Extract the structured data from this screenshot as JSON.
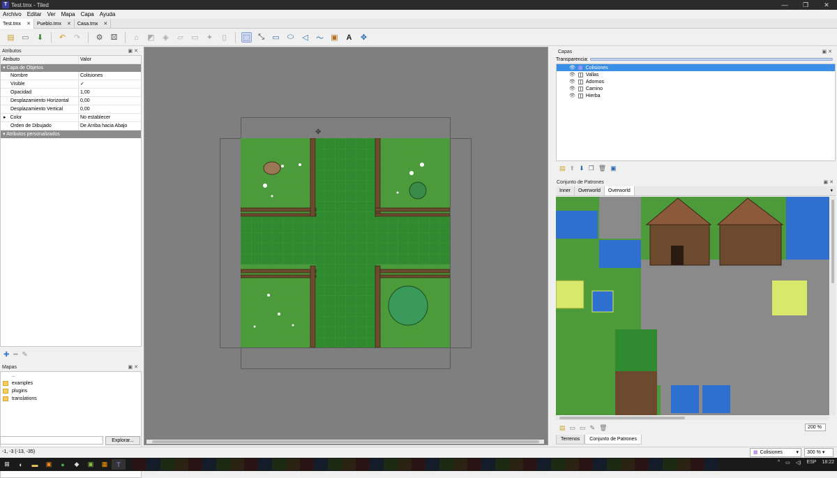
{
  "window": {
    "title": "Test.tmx - Tiled",
    "controls": [
      "—",
      "❐",
      "✕"
    ]
  },
  "menu": [
    "Archivo",
    "Editar",
    "Ver",
    "Mapa",
    "Capa",
    "Ayuda"
  ],
  "tabs": [
    {
      "label": "Test.tmx",
      "active": true
    },
    {
      "label": "Pueblo.tmx",
      "active": false
    },
    {
      "label": "Casa.tmx",
      "active": false
    }
  ],
  "attributes": {
    "title": "Atributos",
    "col_attr": "Atributo",
    "col_value": "Valor",
    "group1": "Capa de Objetos",
    "rows": [
      {
        "key": "Nombre",
        "value": "Colisiones"
      },
      {
        "key": "Visible",
        "value": "✓"
      },
      {
        "key": "Opacidad",
        "value": "1,00"
      },
      {
        "key": "Desplazamiento Horizontal",
        "value": "0,00"
      },
      {
        "key": "Desplazamiento Vertical",
        "value": "0,00"
      },
      {
        "key": "Color",
        "value": "No establecer"
      },
      {
        "key": "Orden de Dibujado",
        "value": "De Arriba hacia Abajo"
      }
    ],
    "group2": "Atributos personalizados"
  },
  "maps": {
    "title": "Mapas",
    "items": [
      "..",
      "examples",
      "plugins",
      "translations"
    ],
    "explore_label": "Explorar..."
  },
  "layers": {
    "title": "Capas",
    "transparency_label": "Transparencia:",
    "items": [
      {
        "name": "Colisiones",
        "selected": true
      },
      {
        "name": "Vallas",
        "selected": false
      },
      {
        "name": "Adornos",
        "selected": false
      },
      {
        "name": "Camino",
        "selected": false
      },
      {
        "name": "Hierba",
        "selected": false
      }
    ]
  },
  "tilesets": {
    "title": "Conjunto de Patrones",
    "tabs": [
      {
        "label": "Inner",
        "active": false
      },
      {
        "label": "Overworld",
        "active": false
      },
      {
        "label": "Overworld",
        "active": true
      }
    ],
    "zoom": "200 %"
  },
  "bottom_tabs": [
    {
      "label": "Terrenos",
      "active": false
    },
    {
      "label": "Conjunto de Patrones",
      "active": true
    }
  ],
  "status": {
    "coords": "-1, -3 (-13, -35)",
    "current_layer": "Colisiones",
    "zoom": "300 %"
  },
  "tray": {
    "lang": "ESP",
    "time": "18:22"
  },
  "colors": {
    "selection": "#3a8ee6",
    "grass": "#4b9b3b",
    "path": "#2f8a30",
    "fence": "#6b4a2e",
    "canvas_bg": "#7f7f7f"
  }
}
